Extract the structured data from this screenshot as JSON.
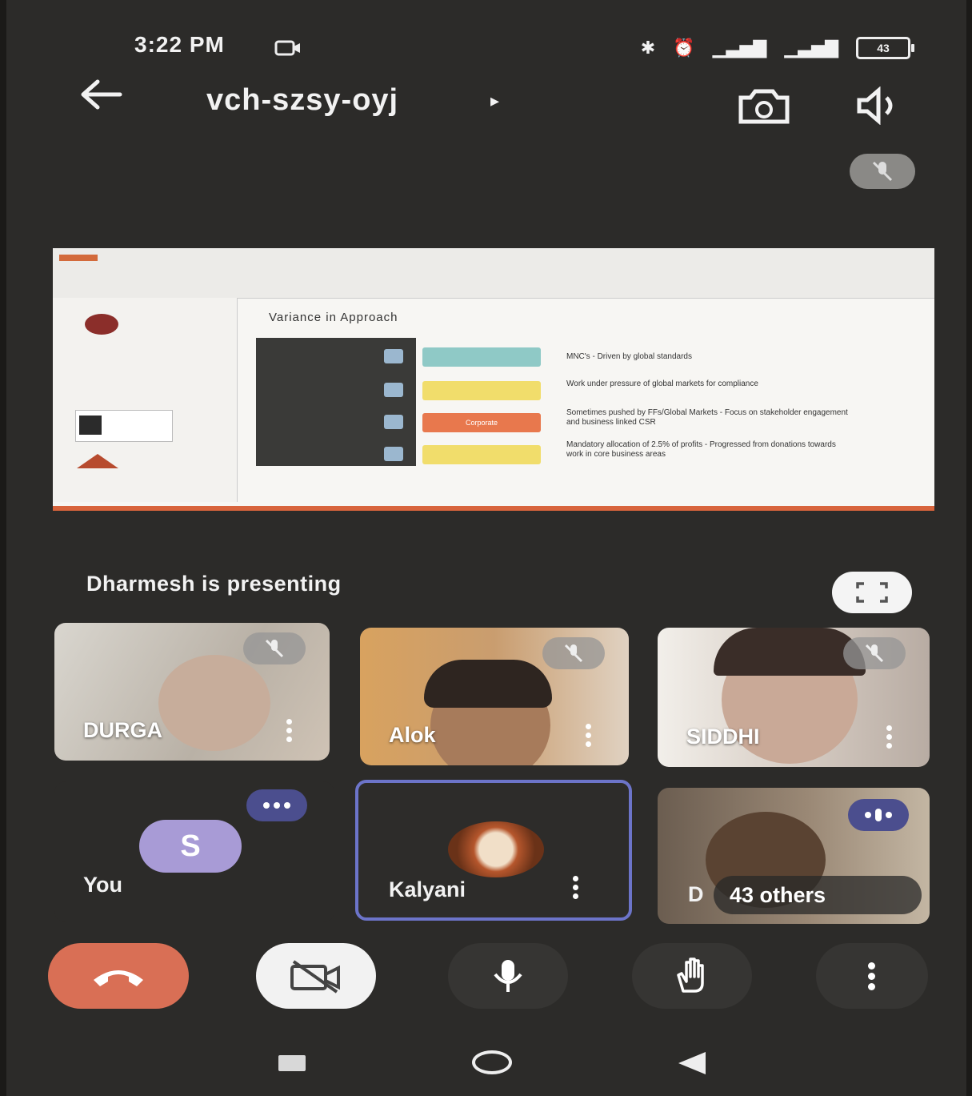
{
  "status_bar": {
    "time": "3:22 PM",
    "battery": "43"
  },
  "header": {
    "meeting_code": "vch-szsy-oyj",
    "caret": "▸"
  },
  "slide": {
    "title": "Variance in Approach",
    "bars": [
      {
        "label": "",
        "color": "#8fc9c6"
      },
      {
        "label": "",
        "color": "#f1dd6b"
      },
      {
        "label": "Corporate",
        "color": "#e8784d"
      },
      {
        "label": "",
        "color": "#f1dd6b"
      }
    ],
    "bullets": [
      "MNC's - Driven by global standards",
      "Work under pressure of global markets for compliance",
      "Sometimes pushed by FFs/Global Markets - Focus on stakeholder engagement and business linked CSR",
      "Mandatory allocation of 2.5% of profits - Progressed from donations towards work in core business areas"
    ]
  },
  "presenting_text": "Dharmesh is presenting",
  "participants": [
    {
      "name": "DURGA",
      "bg": "#c9c4bb"
    },
    {
      "name": "Alok",
      "bg": "#b98f5e"
    },
    {
      "name": "SIDDHI",
      "bg": "#d3cbc3"
    },
    {
      "name": "You",
      "avatar_letter": "S"
    },
    {
      "name": "Kalyani"
    },
    {
      "name": "D",
      "overlay": "43 others"
    }
  ],
  "controls": {
    "end_call": "end-call",
    "camera": "camera-off",
    "mic": "microphone",
    "raise_hand": "raise-hand",
    "more": "more-options"
  }
}
